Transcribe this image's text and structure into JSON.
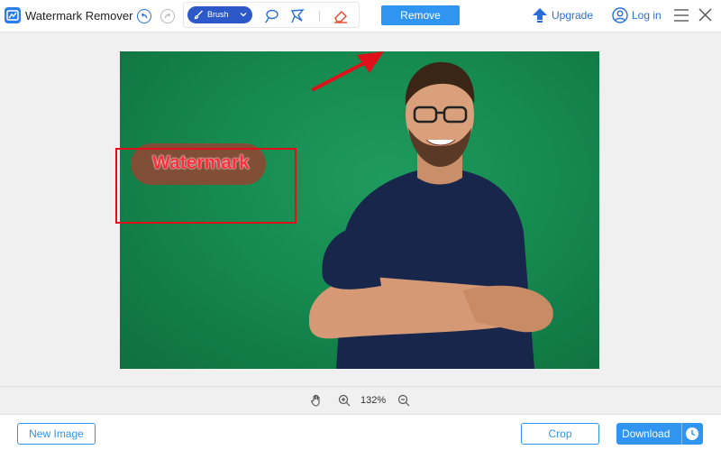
{
  "app": {
    "title": "Watermark Remover"
  },
  "toolbar": {
    "brush_label": "Brush",
    "remove_label": "Remove",
    "upgrade_label": "Upgrade",
    "login_label": "Log in"
  },
  "canvas": {
    "watermark_text": "Watermark"
  },
  "zoom": {
    "level": "132%"
  },
  "bottom": {
    "new_image_label": "New Image",
    "crop_label": "Crop",
    "download_label": "Download"
  },
  "colors": {
    "accent": "#2f95f0",
    "brush_pill": "#2d58c8",
    "annotation_red": "#e0101a",
    "background_green": "#168a4f"
  },
  "icons": [
    "app-logo-icon",
    "undo-icon",
    "redo-icon",
    "brush-icon",
    "chevron-down-icon",
    "lasso-icon",
    "polygon-lasso-icon",
    "eraser-icon",
    "upgrade-arrow-icon",
    "user-icon",
    "menu-icon",
    "close-icon",
    "hand-icon",
    "zoom-in-icon",
    "zoom-out-icon",
    "clock-icon"
  ]
}
